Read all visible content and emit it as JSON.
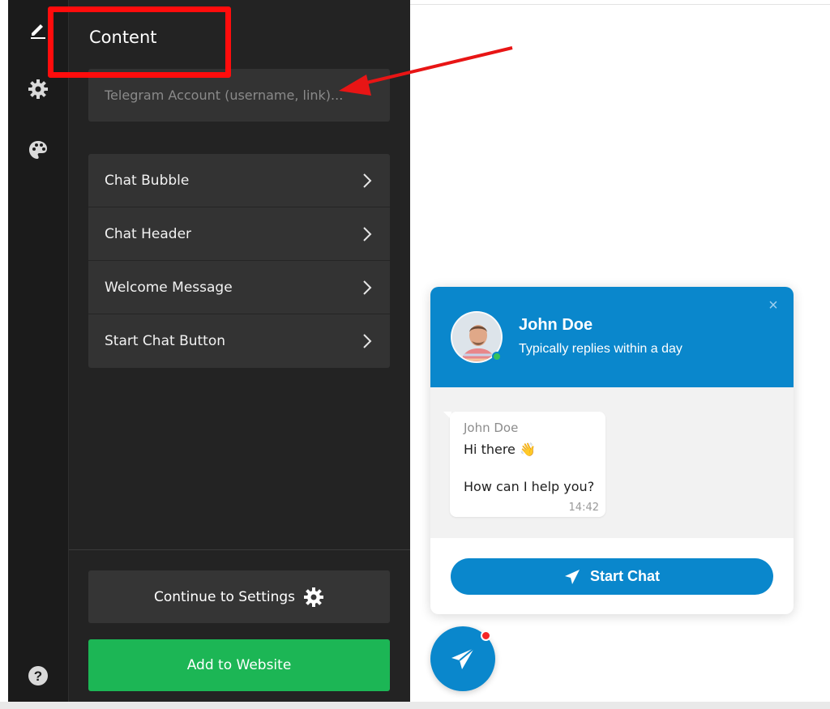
{
  "rail": {
    "icons": [
      "pencil-icon",
      "gear-icon",
      "palette-icon",
      "help-icon"
    ]
  },
  "panel": {
    "title": "Content",
    "telegram_placeholder": "Telegram Account (username, link)...",
    "menu": [
      {
        "label": "Chat Bubble"
      },
      {
        "label": "Chat Header"
      },
      {
        "label": "Welcome Message"
      },
      {
        "label": "Start Chat Button"
      }
    ],
    "continue_label": "Continue to Settings",
    "add_label": "Add to Website"
  },
  "widget": {
    "name": "John Doe",
    "subtitle": "Typically replies within a day",
    "close": "×",
    "message": {
      "author": "John Doe",
      "line1": "Hi there 👋",
      "line2": "How can I help you?",
      "time": "14:42"
    },
    "start_label": "Start Chat"
  },
  "colors": {
    "accent": "#0a87cc",
    "add_button": "#1cb655",
    "annotation": "#ff0c0c",
    "panel_bg": "#232323"
  }
}
